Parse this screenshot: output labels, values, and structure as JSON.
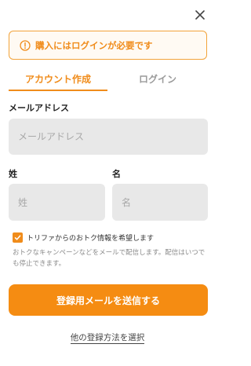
{
  "alert": {
    "text": "購入にはログインが必要です"
  },
  "tabs": [
    {
      "label": "アカウント作成",
      "active": true
    },
    {
      "label": "ログイン",
      "active": false
    }
  ],
  "form": {
    "email": {
      "label": "メールアドレス",
      "placeholder": "メールアドレス",
      "value": ""
    },
    "last_name": {
      "label": "姓",
      "placeholder": "姓",
      "value": ""
    },
    "first_name": {
      "label": "名",
      "placeholder": "名",
      "value": ""
    }
  },
  "consent": {
    "checked": true,
    "label": "トリファからのおトク情報を希望します",
    "note": "おトクなキャンペーンなどをメールで配信します。配信はいつでも停止できます。"
  },
  "submit_label": "登録用メールを送信する",
  "other_method_link": "他の登録方法を選択",
  "colors": {
    "accent": "#f08c1b",
    "button": "#f58c12",
    "input_bg": "#e8e8e8"
  }
}
